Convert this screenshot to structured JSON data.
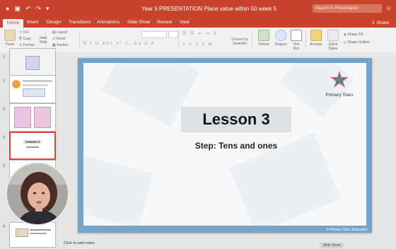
{
  "window": {
    "title": "Year 5 PRESENTATION Place value within 50 week 5",
    "search_placeholder": "Search in Presentation"
  },
  "tabs": [
    "Home",
    "Insert",
    "Design",
    "Transitions",
    "Animations",
    "Slide Show",
    "Review",
    "View"
  ],
  "active_tab": "Home",
  "share_label": "Share",
  "ribbon": {
    "paste": "Paste",
    "cut": "Cut",
    "copy": "Copy",
    "format": "Format",
    "new_slide": "New Slide",
    "layout": "Layout",
    "reset": "Reset",
    "section": "Section",
    "convert": "Convert to SmartArt",
    "picture": "Picture",
    "shapes": "Shapes",
    "text_box": "Text Box",
    "arrange": "Arrange",
    "quick_styles": "Quick Styles",
    "shape_fill": "Shape Fill",
    "shape_outline": "Shape Outline"
  },
  "slide": {
    "title": "Lesson 3",
    "subtitle": "Step: Tens and ones",
    "logo_text": "Primary Stars",
    "copyright": "© Primary Stars Education",
    "accent_color": "#74a4ca"
  },
  "thumbnails": [
    {
      "num": "1"
    },
    {
      "num": "2"
    },
    {
      "num": "3"
    },
    {
      "num": "4",
      "title": "Lesson 3",
      "selected": true
    },
    {
      "num": "5"
    },
    {
      "num": "6"
    }
  ],
  "status": {
    "notes_placeholder": "Click to add notes",
    "slide_show_button": "Slide Show"
  },
  "colors": {
    "titlebar": "#c8432b",
    "selection": "#d9473a"
  }
}
